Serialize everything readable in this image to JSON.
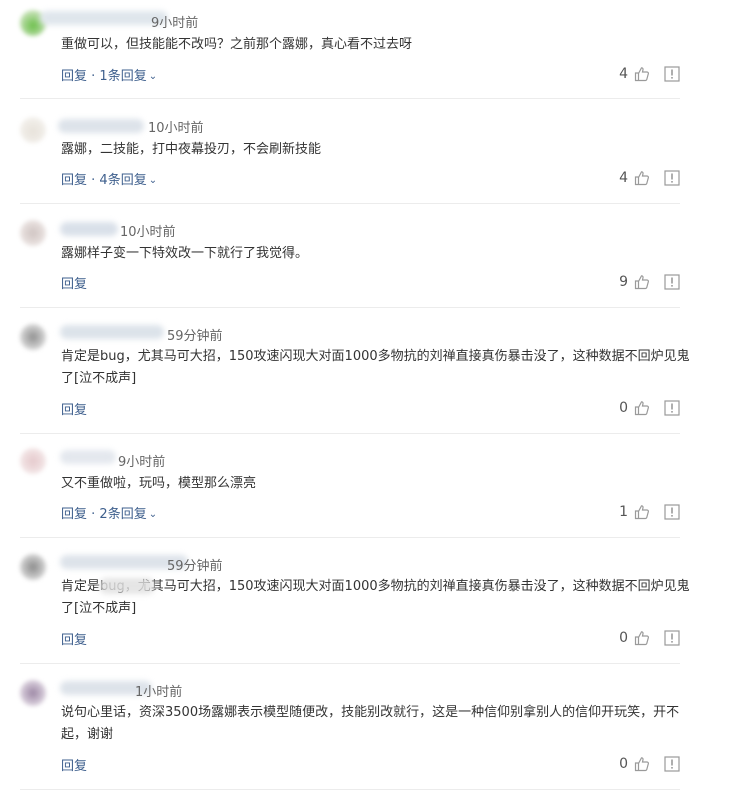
{
  "comments": [
    {
      "time": "9小时前",
      "text": "重做可以，但技能能不改吗？之前那个露娜，真心看不过去呀",
      "reply": "回复",
      "sep": " · ",
      "more": "1条回复",
      "likes": "4"
    },
    {
      "time": "10小时前",
      "text": "露娜，二技能，打中夜幕投刃，不会刷新技能",
      "reply": "回复",
      "sep": " · ",
      "more": "4条回复",
      "likes": "4"
    },
    {
      "time": "10小时前",
      "text": "露娜样子变一下特效改一下就行了我觉得。",
      "reply": "回复",
      "likes": "9"
    },
    {
      "time": "59分钟前",
      "text": "肯定是bug，尤其马可大招，150攻速闪现大对面1000多物抗的刘禅直接真伤暴击没了，这种数据不回炉见鬼了[泣不成声]",
      "reply": "回复",
      "likes": "0"
    },
    {
      "time": "9小时前",
      "text": "又不重做啦，玩吗，模型那么漂亮",
      "reply": "回复",
      "sep": " · ",
      "more": "2条回复",
      "likes": "1"
    },
    {
      "time": "59分钟前",
      "text": "肯定是bug，尤其马可大招，150攻速闪现大对面1000多物抗的刘禅直接真伤暴击没了，这种数据不回炉见鬼了[泣不成声]",
      "reply": "回复",
      "likes": "0"
    },
    {
      "time": "1小时前",
      "text": "说句心里话，资深3500场露娜表示模型随便改，技能别改就行，这是一种信仰别拿别人的信仰开玩笑，开不起，谢谢",
      "reply": "回复",
      "likes": "0"
    }
  ],
  "colors": {
    "link": "#3e5f8d",
    "text": "#333333",
    "meta": "#666666",
    "icon": "#9a9a9a"
  },
  "icons": [
    "thumb-up-icon",
    "report-icon",
    "chevron-down-icon"
  ]
}
